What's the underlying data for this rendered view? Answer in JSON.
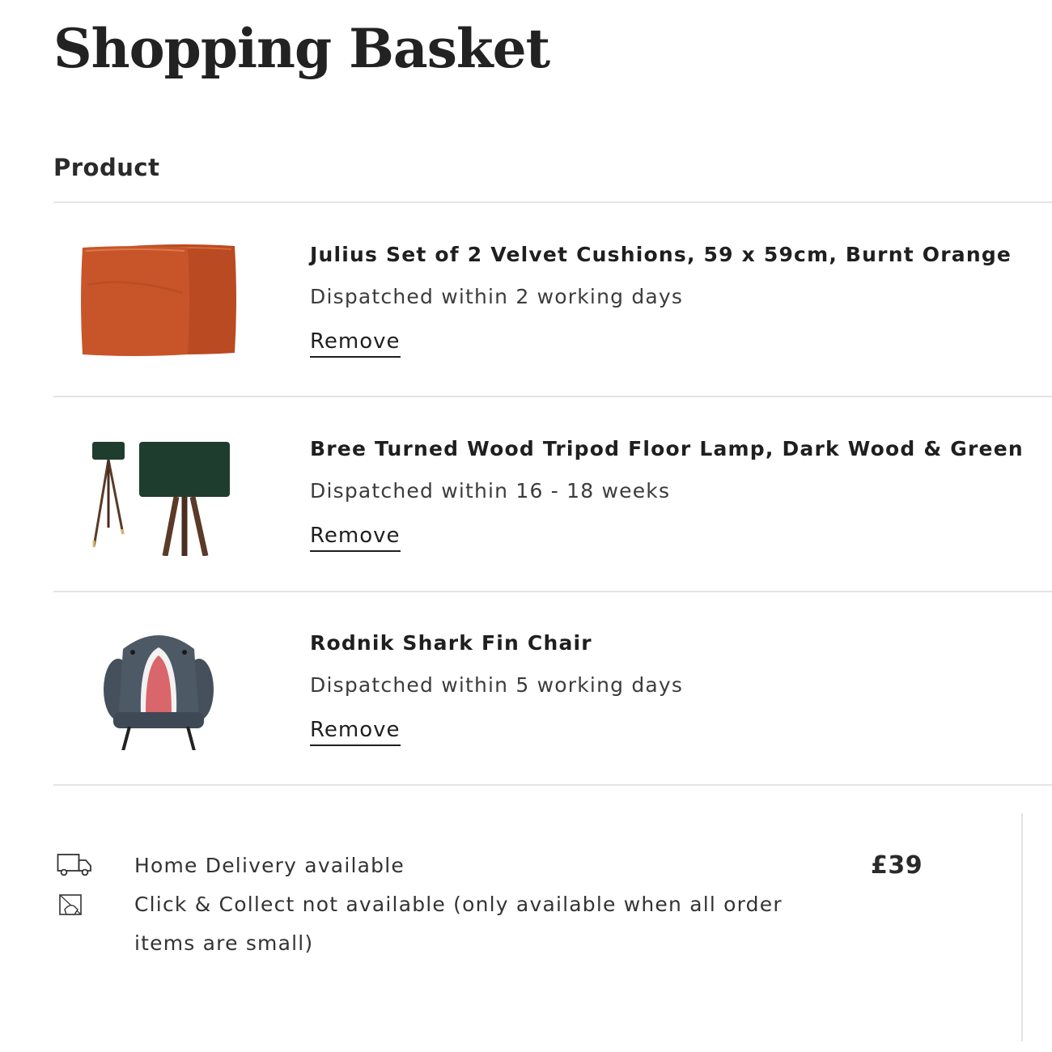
{
  "page": {
    "title": "Shopping Basket"
  },
  "table": {
    "column_header": "Product"
  },
  "items": [
    {
      "name": "Julius Set of 2 Velvet Cushions, 59 x 59cm, Burnt Orange",
      "dispatch": "Dispatched within 2 working days",
      "remove_label": "Remove",
      "image": "orange-velvet-cushions",
      "color": "#c8552a"
    },
    {
      "name": "Bree Turned Wood Tripod Floor Lamp, Dark Wood & Green",
      "dispatch": "Dispatched within 16 - 18 weeks",
      "remove_label": "Remove",
      "image": "green-tripod-floor-lamp",
      "color": "#1f3d2e"
    },
    {
      "name": "Rodnik Shark Fin Chair",
      "dispatch": "Dispatched within 5 working days",
      "remove_label": "Remove",
      "image": "shark-fin-chair",
      "color": "#4a5561"
    }
  ],
  "delivery": {
    "home_icon": "truck-icon",
    "home_text": "Home Delivery available",
    "collect_icon": "click-collect-icon",
    "collect_text": "Click & Collect not available (only available when all order items are small)"
  },
  "summary": {
    "price": "£39"
  }
}
